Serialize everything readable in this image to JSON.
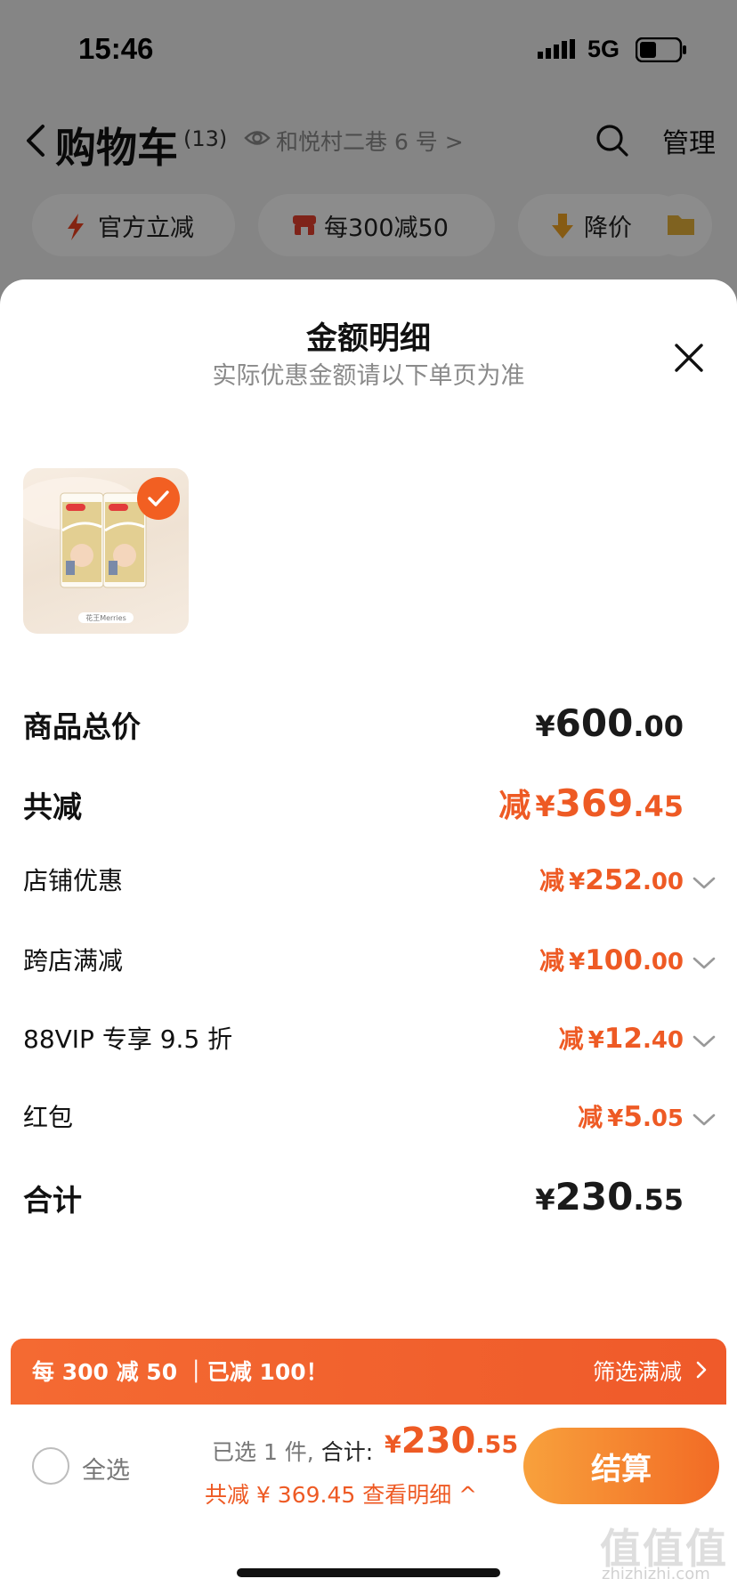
{
  "status_bar": {
    "time": "15:46",
    "network": "5G"
  },
  "cart_header": {
    "title": "购物车",
    "count": "(13)",
    "address": "和悦村二巷 6 号 >",
    "manage": "管理"
  },
  "chips": [
    {
      "label": "官方立减"
    },
    {
      "label": "每300减50"
    },
    {
      "label": "降价"
    }
  ],
  "sheet": {
    "title": "金额明细",
    "subtitle": "实际优惠金额请以下单页为准",
    "product": {
      "label": "花王Merries",
      "selected": true
    }
  },
  "breakdown": {
    "goods_total": {
      "label": "商品总价",
      "yen": "¥",
      "int": "600",
      "dec": ".00"
    },
    "total_discount": {
      "label": "共减",
      "prefix": "减",
      "yen": "¥",
      "int": "369",
      "dec": ".45"
    },
    "items": [
      {
        "label": "店铺优惠",
        "prefix": "减",
        "yen": "¥",
        "int": "252",
        "dec": ".00"
      },
      {
        "label": "跨店满减",
        "prefix": "减",
        "yen": "¥",
        "int": "100",
        "dec": ".00"
      },
      {
        "label": "88VIP 专享 9.5 折",
        "prefix": "减",
        "yen": "¥",
        "int": "12",
        "dec": ".40"
      },
      {
        "label": "红包",
        "prefix": "减",
        "yen": "¥",
        "int": "5",
        "dec": ".05"
      }
    ],
    "grand_total": {
      "label": "合计",
      "yen": "¥",
      "int": "230",
      "dec": ".55"
    }
  },
  "promo_bar": {
    "text": "每 300 减 50 ｜已减 100！",
    "filter": "筛选满减"
  },
  "checkout": {
    "select_all": "全选",
    "selected_text": "已选 1 件,",
    "total_label": " 合计:",
    "total_yen": "¥",
    "total_int": "230",
    "total_dec": ".55",
    "discount_text": "共减 ¥ 369.45  查看明细 ^",
    "button": "结算"
  },
  "watermark": {
    "main": "值值值",
    "sub": "zhizhizhi.com"
  },
  "colors": {
    "accent": "#ee5a24",
    "button_start": "#f8a13c",
    "button_end": "#f26b25"
  }
}
